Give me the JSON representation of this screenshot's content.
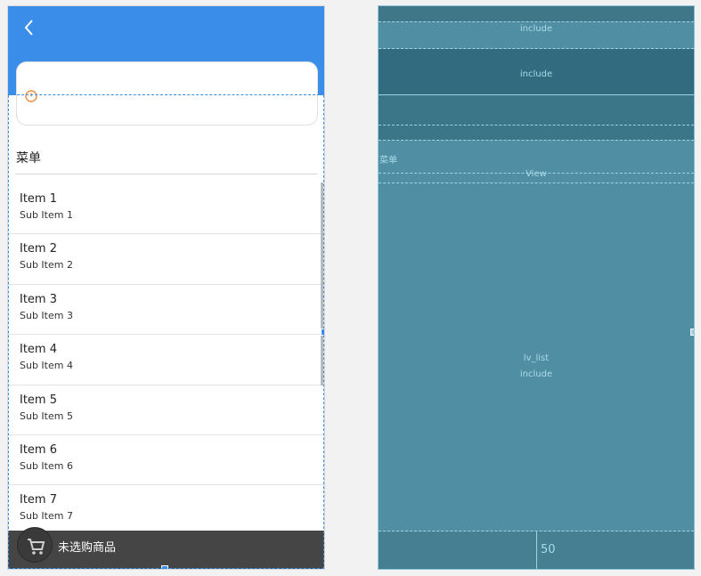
{
  "preview": {
    "menu_title": "菜单",
    "items": [
      {
        "title": "Item 1",
        "sub": "Sub Item 1"
      },
      {
        "title": "Item 2",
        "sub": "Sub Item 2"
      },
      {
        "title": "Item 3",
        "sub": "Sub Item 3"
      },
      {
        "title": "Item 4",
        "sub": "Sub Item 4"
      },
      {
        "title": "Item 5",
        "sub": "Sub Item 5"
      },
      {
        "title": "Item 6",
        "sub": "Sub Item 6"
      },
      {
        "title": "Item 7",
        "sub": "Sub Item 7"
      }
    ],
    "cart_text": "未选购商品",
    "colors": {
      "toolbar": "#3a8de8",
      "cart_bar": "#454545"
    }
  },
  "blueprint": {
    "include_top": "include",
    "include_card": "include",
    "menu_label": "菜单",
    "view_label": "View",
    "list_id": "lv_list",
    "list_include": "include",
    "bottom_number": "50",
    "colors": {
      "bg": "#508ea3"
    }
  },
  "icons": {
    "back": "chevron-left-icon",
    "clock": "clock-icon",
    "cart": "cart-icon"
  }
}
